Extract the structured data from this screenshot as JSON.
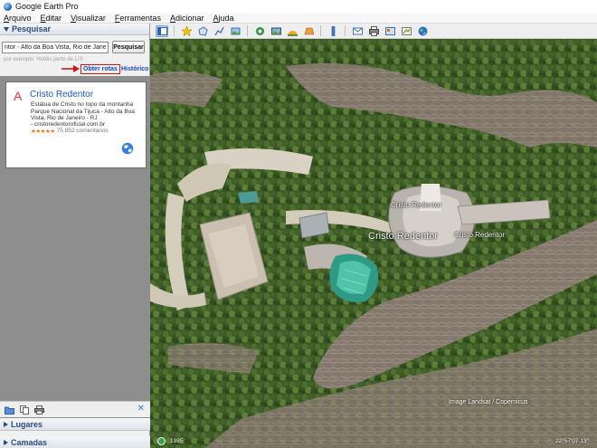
{
  "window": {
    "title": "Google Earth Pro"
  },
  "menu": [
    "Arquivo",
    "Editar",
    "Visualizar",
    "Ferramentas",
    "Adicionar",
    "Ajuda"
  ],
  "toolbar_icons": [
    "sidebar-toggle-icon",
    "placemark-icon",
    "polygon-icon",
    "path-icon",
    "image-overlay-icon",
    "record-tour-icon",
    "historical-imagery-icon",
    "sunlight-icon",
    "planets-icon",
    "ruler-icon",
    "email-icon",
    "print-icon",
    "save-image-icon",
    "view-in-maps-icon",
    "earth-icon"
  ],
  "search": {
    "header": "Pesquisar",
    "input_value": "ntor - Alto da Boa Vista, Rio de Janeiro - RJ",
    "button_label": "Pesquisar",
    "hint": "por exemplo: Hotéis perto de LIS",
    "route_link": "Obter rotas",
    "history_link": "Histórico"
  },
  "result": {
    "marker": "A",
    "title": "Cristo Redentor",
    "description": "Estátua de Cristo no topo da montanha Parque Nacional da Tijuca - Alto da Boa Vista, Rio de Janeiro - RJ",
    "url": "- cristoredentoroficial.com.br",
    "stars": "★★★★★",
    "reviews": "75.852 comentários"
  },
  "panels": {
    "places": "Lugares",
    "layers": "Camadas",
    "close": "✕"
  },
  "map": {
    "label_main": "Cristo Redentor",
    "label_left": "Cristo Redentor",
    "label_right": "Cristo Redentor",
    "credits": "Image Landsat / Copernicus",
    "year": "1985",
    "coords": "22°57'07.13\""
  },
  "colors": {
    "accent": "#1a54c8",
    "highlight": "#d21414",
    "marker": "#d93838"
  }
}
